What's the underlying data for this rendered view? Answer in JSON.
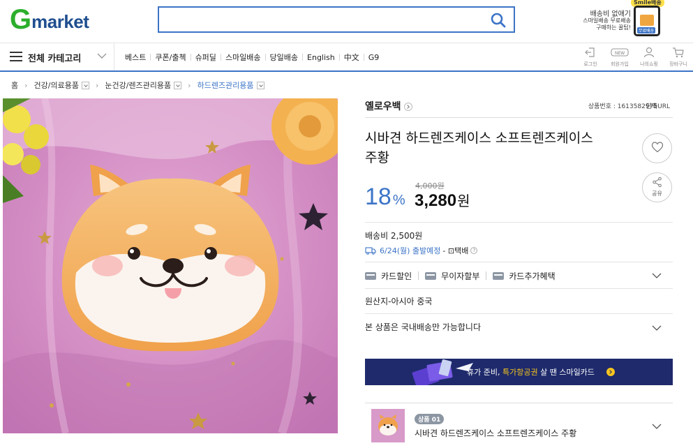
{
  "header": {
    "logo_g": "G",
    "logo_rest": "market",
    "search_value": "",
    "search_icon": "search-icon",
    "promo": {
      "badge": "Smile배송",
      "title": "배송비 없애기",
      "sub1": "스마일배송 무료배송",
      "sub2": "구매하는 꿀팁!",
      "tag": "무료배송"
    }
  },
  "nav": {
    "category_label": "전체 카테고리",
    "menu": [
      "베스트",
      "쿠폰/출첵",
      "슈퍼딜",
      "스마일배송",
      "당일배송",
      "English",
      "中文",
      "G9"
    ],
    "icons": [
      {
        "label": "로그인",
        "icon": "login-icon"
      },
      {
        "label": "회원가입",
        "icon": "new-badge-icon"
      },
      {
        "label": "나의쇼핑",
        "icon": "person-icon"
      },
      {
        "label": "장바구니",
        "icon": "cart-icon"
      }
    ]
  },
  "breadcrumb": {
    "home": "홈",
    "level1": "건강/의료용품",
    "level2": "눈건강/렌즈관리용품",
    "level3": "하드렌즈관리용품"
  },
  "product": {
    "seller": "옐로우백",
    "product_no": "상품번호 : 1613582975",
    "short_url": "단축URL",
    "title": "시바견 하드렌즈케이스 소프트렌즈케이스 주황",
    "share_label": "공유",
    "discount_rate": "18",
    "discount_unit": "%",
    "original_price": "4,000원",
    "price": "3,280",
    "price_unit": "원",
    "shipping_fee": "배송비 2,500원",
    "ship_date": "6/24(월) 출발예정",
    "ship_method": "- ⊡택배",
    "benefits": [
      "카드할인",
      "무이자할부",
      "카드추가혜택"
    ],
    "origin": "원산지-아시아 중국",
    "domestic_only": "본 상품은 국내배송만 가능합니다",
    "banner": {
      "text_before": "휴가 준비,",
      "highlight": "특가항공권",
      "text_after": "살 땐 스마일카드"
    },
    "option": {
      "badge": "상품 01",
      "name": "시바견 하드렌즈케이스 소프트렌즈케이스 주황"
    }
  },
  "colors": {
    "brand_green": "#2cae2c",
    "brand_blue": "#1f4e8f",
    "accent_blue": "#3c74c7",
    "banner_bg": "#1e2a6b",
    "banner_highlight": "#f7c51e"
  }
}
